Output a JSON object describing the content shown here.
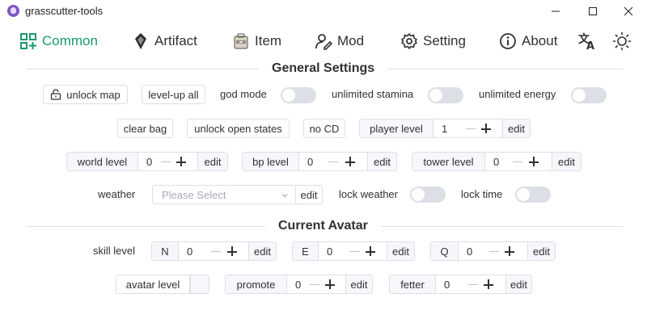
{
  "window": {
    "title": "grasscutter-tools"
  },
  "nav": {
    "items": [
      {
        "label": "Common",
        "icon": "dashboard-icon",
        "active": true
      },
      {
        "label": "Artifact",
        "icon": "artifact-icon"
      },
      {
        "label": "Item",
        "icon": "backpack-icon"
      },
      {
        "label": "Mod",
        "icon": "user-edit-icon"
      },
      {
        "label": "Setting",
        "icon": "gear-icon"
      },
      {
        "label": "About",
        "icon": "info-icon"
      }
    ],
    "tools": [
      "translate-icon",
      "theme-icon"
    ]
  },
  "general": {
    "title": "General Settings",
    "unlock_map": "unlock map",
    "level_up_all": "level-up all",
    "god_mode": "god mode",
    "unlimited_stamina": "unlimited stamina",
    "unlimited_energy": "unlimited energy",
    "clear_bag": "clear bag",
    "unlock_open_states": "unlock open states",
    "no_cd": "no CD",
    "player_level": {
      "label": "player level",
      "value": "1",
      "action": "edit"
    },
    "world_level": {
      "label": "world level",
      "value": "0",
      "action": "edit"
    },
    "bp_level": {
      "label": "bp level",
      "value": "0",
      "action": "edit"
    },
    "tower_level": {
      "label": "tower level",
      "value": "0",
      "action": "edit"
    },
    "weather": {
      "label": "weather",
      "placeholder": "Please Select",
      "action": "edit"
    },
    "lock_weather": "lock weather",
    "lock_time": "lock time"
  },
  "avatar": {
    "title": "Current Avatar",
    "skill_level": "skill level",
    "skills": [
      {
        "key": "N",
        "value": "0",
        "action": "edit"
      },
      {
        "key": "E",
        "value": "0",
        "action": "edit"
      },
      {
        "key": "Q",
        "value": "0",
        "action": "edit"
      }
    ],
    "avatar_level": {
      "label": "avatar level",
      "value": ""
    },
    "promote": {
      "label": "promote",
      "value": "0",
      "action": "edit"
    },
    "fetter": {
      "label": "fetter",
      "value": "0",
      "action": "edit"
    }
  },
  "colors": {
    "accent": "#1a9a6b",
    "border": "#dcdfe6",
    "switch_off": "#dcdfe6",
    "addon_bg": "#f5f7fa"
  }
}
